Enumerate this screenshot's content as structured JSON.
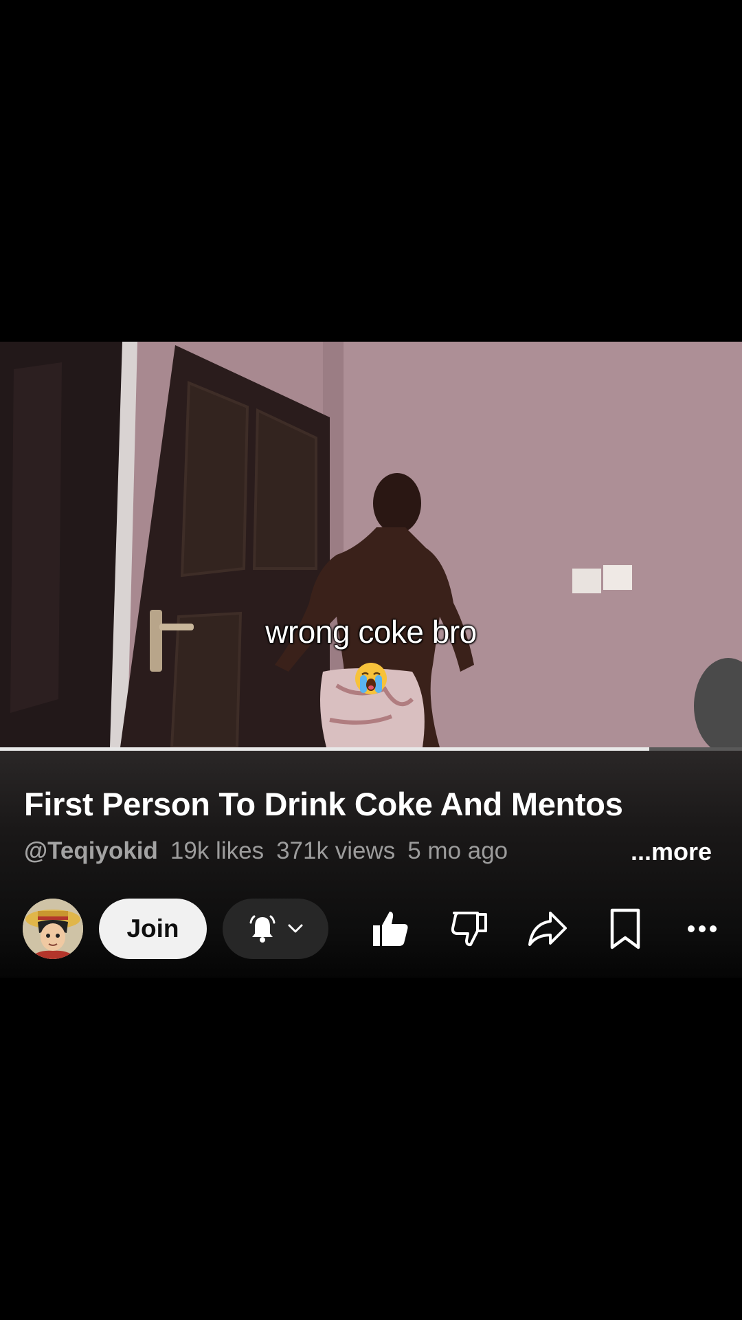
{
  "video": {
    "caption": "wrong coke bro",
    "caption_emoji": "loudly-crying-face",
    "progress_fraction": 0.875
  },
  "info": {
    "title": "First Person To Drink Coke And Mentos",
    "channel_handle": "@Teqiyokid",
    "likes": "19k likes",
    "views": "371k views",
    "age": "5 mo ago",
    "more_label": "...more"
  },
  "actions": {
    "join_label": "Join",
    "icons": [
      "bell-icon",
      "chevron-down-icon",
      "like-icon",
      "dislike-icon",
      "share-icon",
      "save-icon",
      "more-options-icon"
    ]
  },
  "colors": {
    "background": "#000000",
    "join_bg": "#f1f1f1",
    "bell_bg": "#272727",
    "meta_text": "#9c9c9c"
  }
}
